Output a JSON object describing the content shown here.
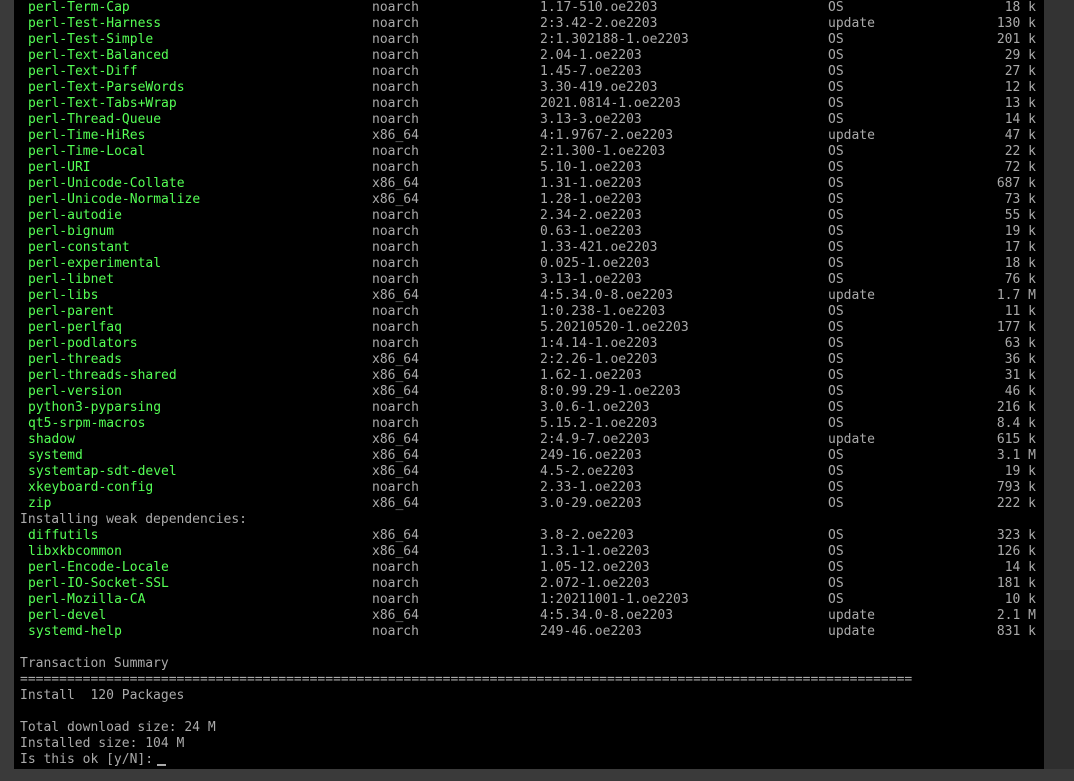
{
  "colors": {
    "package_name": "#55ff55",
    "text": "#aaaaaa",
    "background": "#000000"
  },
  "packages_top": [
    {
      "name": "perl-Term-Cap",
      "arch": "noarch",
      "version": "1.17-510.oe2203",
      "repo": "OS",
      "size": "18 k"
    },
    {
      "name": "perl-Test-Harness",
      "arch": "noarch",
      "version": "2:3.42-2.oe2203",
      "repo": "update",
      "size": "130 k"
    },
    {
      "name": "perl-Test-Simple",
      "arch": "noarch",
      "version": "2:1.302188-1.oe2203",
      "repo": "OS",
      "size": "201 k"
    },
    {
      "name": "perl-Text-Balanced",
      "arch": "noarch",
      "version": "2.04-1.oe2203",
      "repo": "OS",
      "size": "29 k"
    },
    {
      "name": "perl-Text-Diff",
      "arch": "noarch",
      "version": "1.45-7.oe2203",
      "repo": "OS",
      "size": "27 k"
    },
    {
      "name": "perl-Text-ParseWords",
      "arch": "noarch",
      "version": "3.30-419.oe2203",
      "repo": "OS",
      "size": "12 k"
    },
    {
      "name": "perl-Text-Tabs+Wrap",
      "arch": "noarch",
      "version": "2021.0814-1.oe2203",
      "repo": "OS",
      "size": "13 k"
    },
    {
      "name": "perl-Thread-Queue",
      "arch": "noarch",
      "version": "3.13-3.oe2203",
      "repo": "OS",
      "size": "14 k"
    },
    {
      "name": "perl-Time-HiRes",
      "arch": "x86_64",
      "version": "4:1.9767-2.oe2203",
      "repo": "update",
      "size": "47 k"
    },
    {
      "name": "perl-Time-Local",
      "arch": "noarch",
      "version": "2:1.300-1.oe2203",
      "repo": "OS",
      "size": "22 k"
    },
    {
      "name": "perl-URI",
      "arch": "noarch",
      "version": "5.10-1.oe2203",
      "repo": "OS",
      "size": "72 k"
    },
    {
      "name": "perl-Unicode-Collate",
      "arch": "x86_64",
      "version": "1.31-1.oe2203",
      "repo": "OS",
      "size": "687 k"
    },
    {
      "name": "perl-Unicode-Normalize",
      "arch": "x86_64",
      "version": "1.28-1.oe2203",
      "repo": "OS",
      "size": "73 k"
    },
    {
      "name": "perl-autodie",
      "arch": "noarch",
      "version": "2.34-2.oe2203",
      "repo": "OS",
      "size": "55 k"
    },
    {
      "name": "perl-bignum",
      "arch": "noarch",
      "version": "0.63-1.oe2203",
      "repo": "OS",
      "size": "19 k"
    },
    {
      "name": "perl-constant",
      "arch": "noarch",
      "version": "1.33-421.oe2203",
      "repo": "OS",
      "size": "17 k"
    },
    {
      "name": "perl-experimental",
      "arch": "noarch",
      "version": "0.025-1.oe2203",
      "repo": "OS",
      "size": "18 k"
    },
    {
      "name": "perl-libnet",
      "arch": "noarch",
      "version": "3.13-1.oe2203",
      "repo": "OS",
      "size": "76 k"
    },
    {
      "name": "perl-libs",
      "arch": "x86_64",
      "version": "4:5.34.0-8.oe2203",
      "repo": "update",
      "size": "1.7 M"
    },
    {
      "name": "perl-parent",
      "arch": "noarch",
      "version": "1:0.238-1.oe2203",
      "repo": "OS",
      "size": "11 k"
    },
    {
      "name": "perl-perlfaq",
      "arch": "noarch",
      "version": "5.20210520-1.oe2203",
      "repo": "OS",
      "size": "177 k"
    },
    {
      "name": "perl-podlators",
      "arch": "noarch",
      "version": "1:4.14-1.oe2203",
      "repo": "OS",
      "size": "63 k"
    },
    {
      "name": "perl-threads",
      "arch": "x86_64",
      "version": "2:2.26-1.oe2203",
      "repo": "OS",
      "size": "36 k"
    },
    {
      "name": "perl-threads-shared",
      "arch": "x86_64",
      "version": "1.62-1.oe2203",
      "repo": "OS",
      "size": "31 k"
    },
    {
      "name": "perl-version",
      "arch": "x86_64",
      "version": "8:0.99.29-1.oe2203",
      "repo": "OS",
      "size": "46 k"
    },
    {
      "name": "python3-pyparsing",
      "arch": "noarch",
      "version": "3.0.6-1.oe2203",
      "repo": "OS",
      "size": "216 k"
    },
    {
      "name": "qt5-srpm-macros",
      "arch": "noarch",
      "version": "5.15.2-1.oe2203",
      "repo": "OS",
      "size": "8.4 k"
    },
    {
      "name": "shadow",
      "arch": "x86_64",
      "version": "2:4.9-7.oe2203",
      "repo": "update",
      "size": "615 k"
    },
    {
      "name": "systemd",
      "arch": "x86_64",
      "version": "249-16.oe2203",
      "repo": "OS",
      "size": "3.1 M"
    },
    {
      "name": "systemtap-sdt-devel",
      "arch": "x86_64",
      "version": "4.5-2.oe2203",
      "repo": "OS",
      "size": "19 k"
    },
    {
      "name": "xkeyboard-config",
      "arch": "noarch",
      "version": "2.33-1.oe2203",
      "repo": "OS",
      "size": "793 k"
    },
    {
      "name": "zip",
      "arch": "x86_64",
      "version": "3.0-29.oe2203",
      "repo": "OS",
      "size": "222 k"
    }
  ],
  "weak_header": "Installing weak dependencies:",
  "packages_weak": [
    {
      "name": "diffutils",
      "arch": "x86_64",
      "version": "3.8-2.oe2203",
      "repo": "OS",
      "size": "323 k"
    },
    {
      "name": "libxkbcommon",
      "arch": "x86_64",
      "version": "1.3.1-1.oe2203",
      "repo": "OS",
      "size": "126 k"
    },
    {
      "name": "perl-Encode-Locale",
      "arch": "noarch",
      "version": "1.05-12.oe2203",
      "repo": "OS",
      "size": "14 k"
    },
    {
      "name": "perl-IO-Socket-SSL",
      "arch": "noarch",
      "version": "2.072-1.oe2203",
      "repo": "OS",
      "size": "181 k"
    },
    {
      "name": "perl-Mozilla-CA",
      "arch": "noarch",
      "version": "1:20211001-1.oe2203",
      "repo": "OS",
      "size": "10 k"
    },
    {
      "name": "perl-devel",
      "arch": "x86_64",
      "version": "4:5.34.0-8.oe2203",
      "repo": "update",
      "size": "2.1 M"
    },
    {
      "name": "systemd-help",
      "arch": "noarch",
      "version": "249-46.oe2203",
      "repo": "update",
      "size": "831 k"
    }
  ],
  "summary": {
    "title": "Transaction Summary",
    "separator": "==================================================================================================================",
    "install_line": "Install  120 Packages",
    "download_size": "Total download size: 24 M",
    "installed_size": "Installed size: 104 M",
    "prompt": "Is this ok [y/N]:"
  }
}
